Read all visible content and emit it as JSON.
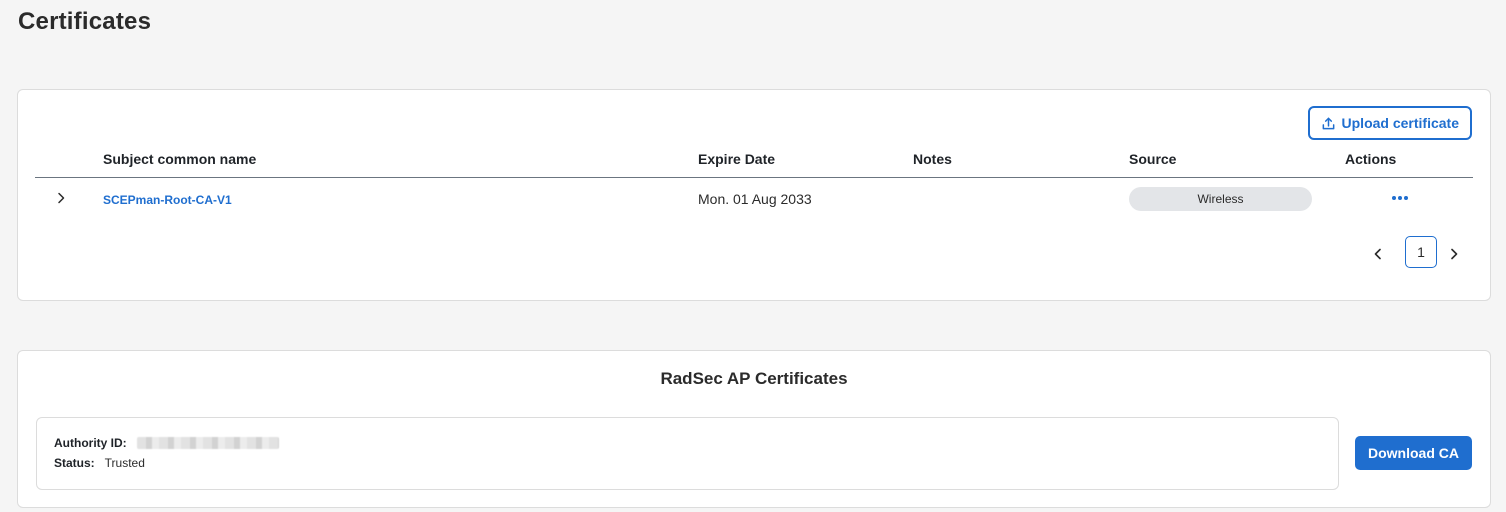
{
  "page": {
    "title": "Certificates"
  },
  "certificates": {
    "upload_label": "Upload certificate",
    "columns": {
      "name": "Subject common name",
      "expire": "Expire Date",
      "notes": "Notes",
      "source": "Source",
      "actions": "Actions"
    },
    "rows": [
      {
        "name": "SCEPman-Root-CA-V1",
        "expire": "Mon. 01 Aug 2033",
        "notes": "",
        "source": "Wireless"
      }
    ],
    "pagination": {
      "current_page": "1"
    }
  },
  "radsec": {
    "title": "RadSec AP Certificates",
    "authority_label": "Authority ID:",
    "status_label": "Status:",
    "status_value": "Trusted",
    "download_label": "Download CA"
  },
  "colors": {
    "accent": "#1f6ecf",
    "pill_bg": "#e3e5e8",
    "page_bg": "#f5f5f5"
  },
  "icons": {
    "upload": "upload-icon",
    "expand": "chevron-right-icon",
    "actions": "more-horizontal-icon",
    "prev": "chevron-left-icon",
    "next": "chevron-right-icon"
  }
}
